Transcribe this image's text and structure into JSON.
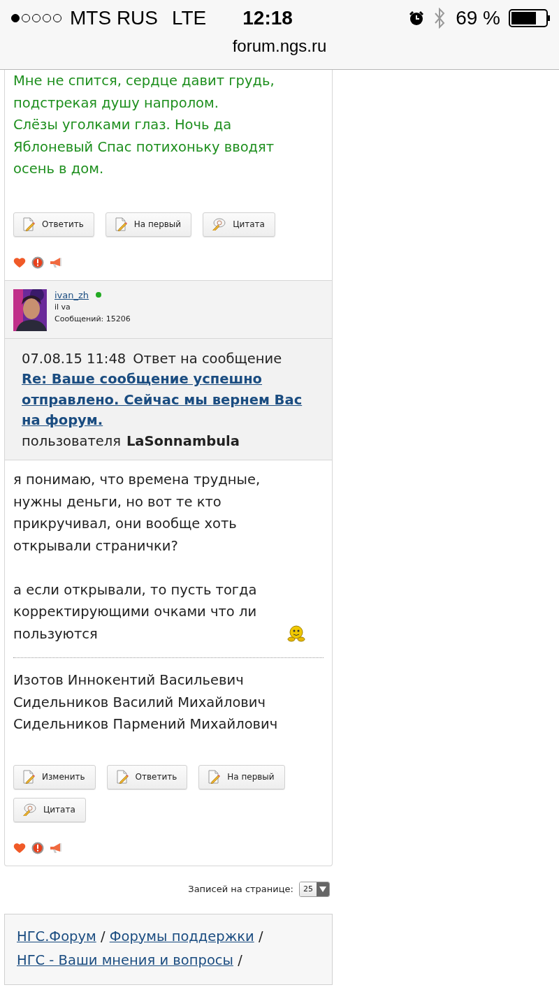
{
  "status_bar": {
    "carrier": "MTS RUS",
    "network": "LTE",
    "time": "12:18",
    "battery": "69 %",
    "url": "forum.ngs.ru"
  },
  "previous_post": {
    "text_lines": [
      "Мне не спится, сердце давит грудь,",
      "подстрекая душу напролом.",
      "Слёзы уголками глаз. Ночь да",
      "Яблоневый Спас потихоньку вводят",
      "осень в дом."
    ],
    "buttons": [
      {
        "label": "Ответить",
        "kind": "reply"
      },
      {
        "label": "На первый",
        "kind": "reply"
      },
      {
        "label": "Цитата",
        "kind": "quote"
      }
    ]
  },
  "post": {
    "author": "ivan_zh",
    "online": true,
    "signature": "il va",
    "posts_count": "Сообщений: 15206",
    "date": "07.08.15 11:48",
    "reply_prefix": "Ответ на сообщение",
    "reply_title": "Re: Ваше сообщение успешно отправлено. Сейчас мы вернем Вас на форум.",
    "reply_user_prefix": "пользователя",
    "reply_user": "LaSonnambula",
    "paragraphs": [
      {
        "text": "я понимаю, что времена трудные, нужны деньги, но вот те кто прикручивал, они вообще хоть открывали странички?",
        "smiley": false
      },
      {
        "text": "а если открывали, то пусть тогда корректирующими очками что ли пользуются",
        "smiley": true
      }
    ],
    "signature_lines": [
      "Изотов Иннокентий Васильевич",
      "Сидельников Василий Михайлович",
      "Сидельников Пармений Михайлович"
    ],
    "buttons": [
      {
        "label": "Изменить",
        "kind": "reply"
      },
      {
        "label": "Ответить",
        "kind": "reply"
      },
      {
        "label": "На первый",
        "kind": "reply"
      },
      {
        "label": "Цитата",
        "kind": "quote"
      }
    ]
  },
  "pager": {
    "label": "Записей на странице:",
    "value": "25"
  },
  "breadcrumbs": [
    {
      "label": "НГС.Форум",
      "separator": "/"
    },
    {
      "label": "Форумы поддержки",
      "separator": "/"
    },
    {
      "label": "НГС - Ваши мнения и вопросы",
      "separator": "/"
    }
  ]
}
